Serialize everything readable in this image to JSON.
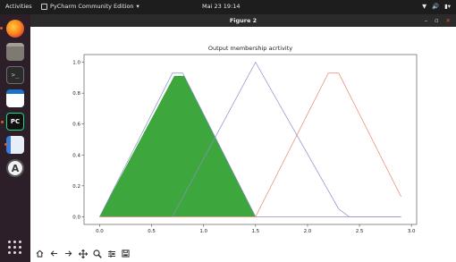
{
  "topbar": {
    "activities": "Activities",
    "app_name": "PyCharm Community Edition",
    "app_menu_arrow": "▾",
    "clock": "Mai 23  19:14",
    "tray_network": "▼",
    "tray_sound": "🔊",
    "tray_power": "▮▾"
  },
  "dock": {
    "items": [
      {
        "icon": "firefox-icon"
      },
      {
        "icon": "files-icon"
      },
      {
        "icon": "terminal-icon",
        "glyph": ">_"
      },
      {
        "icon": "libreoffice-writer-icon"
      },
      {
        "icon": "pycharm-icon",
        "glyph": "PC"
      },
      {
        "icon": "text-editor-icon"
      },
      {
        "icon": "software-center-icon",
        "glyph": "A"
      }
    ]
  },
  "window": {
    "title": "Figure 2",
    "controls": {
      "minimize": "–",
      "maximize": "▫",
      "close": "✕"
    }
  },
  "toolbar": {
    "tools": [
      "home-icon",
      "back-arrow-icon",
      "forward-arrow-icon",
      "pan-icon",
      "zoom-icon",
      "subplot-config-icon",
      "save-icon"
    ]
  },
  "colors": {
    "blue_series": "#8a8fc9",
    "orange_series": "#e8876b",
    "green_fill": "#2ca02c",
    "dock_bg": "#2c1f2a",
    "topbar_bg": "#1d1d1d",
    "accent": "#e95420"
  },
  "chart_data": {
    "type": "line",
    "title": "Output membership acrtivity",
    "xlabel": "",
    "ylabel": "",
    "xlim": [
      -0.15,
      3.05
    ],
    "ylim": [
      -0.05,
      1.05
    ],
    "xticks": [
      "0.0",
      "0.5",
      "1.0",
      "1.5",
      "2.0",
      "2.5",
      "3.0"
    ],
    "yticks": [
      "0.0",
      "0.2",
      "0.4",
      "0.6",
      "0.8",
      "1.0"
    ],
    "grid": false,
    "series": [
      {
        "color": "#8a8fc9",
        "x": [
          0.0,
          0.7,
          0.8,
          1.5,
          2.9
        ],
        "y": [
          0.0,
          0.93,
          0.93,
          0.0,
          0.0
        ]
      },
      {
        "color": "#8a8fc9",
        "x": [
          0.0,
          0.7,
          1.5,
          2.3,
          2.4,
          2.9
        ],
        "y": [
          0.0,
          0.0,
          1.0,
          0.05,
          0.0,
          0.0
        ]
      },
      {
        "color": "#e8876b",
        "x": [
          0.0,
          1.5,
          2.2,
          2.3,
          2.9
        ],
        "y": [
          0.0,
          0.0,
          0.93,
          0.93,
          0.13
        ]
      }
    ],
    "fill": {
      "color": "#2ca02c",
      "x": [
        0.0,
        0.72,
        0.81,
        1.5
      ],
      "y": [
        0.0,
        0.91,
        0.91,
        0.0
      ]
    }
  }
}
